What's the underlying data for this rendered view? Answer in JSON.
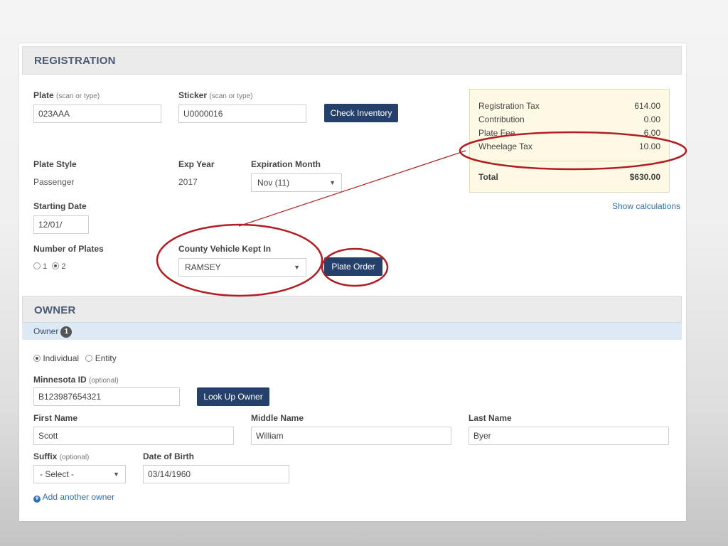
{
  "registration": {
    "section_title": "REGISTRATION",
    "plate": {
      "label": "Plate",
      "hint": "(scan or type)",
      "value": "023AAA"
    },
    "sticker": {
      "label": "Sticker",
      "hint": "(scan or type)",
      "value": "U0000016"
    },
    "check_inventory_label": "Check Inventory",
    "plate_style": {
      "label": "Plate Style",
      "value": "Passenger"
    },
    "exp_year": {
      "label": "Exp Year",
      "value": "2017"
    },
    "expiration_month": {
      "label": "Expiration Month",
      "value": "Nov (11)"
    },
    "starting_date": {
      "label": "Starting Date",
      "value": "12/01/"
    },
    "number_of_plates": {
      "label": "Number of Plates",
      "options": [
        "1",
        "2"
      ],
      "selected": "2"
    },
    "county": {
      "label": "County Vehicle Kept In",
      "value": "RAMSEY"
    },
    "plate_order_label": "Plate Order",
    "fees": [
      {
        "name": "Registration Tax",
        "amount": "614.00"
      },
      {
        "name": "Contribution",
        "amount": "0.00"
      },
      {
        "name": "Plate Fee",
        "amount": "6.00"
      },
      {
        "name": "Wheelage Tax",
        "amount": "10.00"
      }
    ],
    "total": {
      "label": "Total",
      "amount": "$630.00"
    },
    "show_calculations_label": "Show calculations"
  },
  "owner": {
    "section_title": "OWNER",
    "tab_label": "Owner",
    "tab_count": "1",
    "type_options": [
      "Individual",
      "Entity"
    ],
    "type_selected": "Individual",
    "minnesota_id": {
      "label": "Minnesota ID",
      "hint": "(optional)",
      "value": "B123987654321"
    },
    "look_up_owner_label": "Look Up Owner",
    "first_name": {
      "label": "First Name",
      "value": "Scott"
    },
    "middle_name": {
      "label": "Middle Name",
      "value": "William"
    },
    "last_name": {
      "label": "Last Name",
      "value": "Byer"
    },
    "suffix": {
      "label": "Suffix",
      "hint": "(optional)",
      "value": "- Select -"
    },
    "date_of_birth": {
      "label": "Date of Birth",
      "value": "03/14/1960"
    },
    "add_owner_label": "Add another owner"
  },
  "annotation_color": "#b01e23",
  "colors": {
    "primary_button": "#25416b",
    "link": "#2e6fb4",
    "fee_box": "#fdf9e4",
    "owner_tab": "#ddeaf6"
  }
}
